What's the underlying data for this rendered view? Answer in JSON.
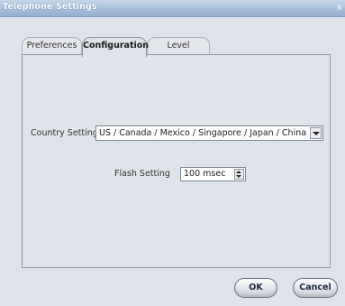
{
  "window": {
    "title": "Telephone Settings",
    "close_glyph": "x"
  },
  "tabs": [
    {
      "label": "Preferences",
      "active": false
    },
    {
      "label": "Configuration",
      "active": true
    },
    {
      "label": "Level",
      "active": false
    }
  ],
  "configuration": {
    "country_label": "Country Setting",
    "country_value": "US / Canada / Mexico / Singapore / Japan / China",
    "flash_label": "Flash Setting",
    "flash_value": "100 msec"
  },
  "buttons": {
    "ok_label": "OK",
    "cancel_label": "Cancel"
  },
  "icons": {
    "close": "close-icon",
    "dropdown": "chevron-down-icon",
    "spinner": "spinner-arrows-icon"
  }
}
